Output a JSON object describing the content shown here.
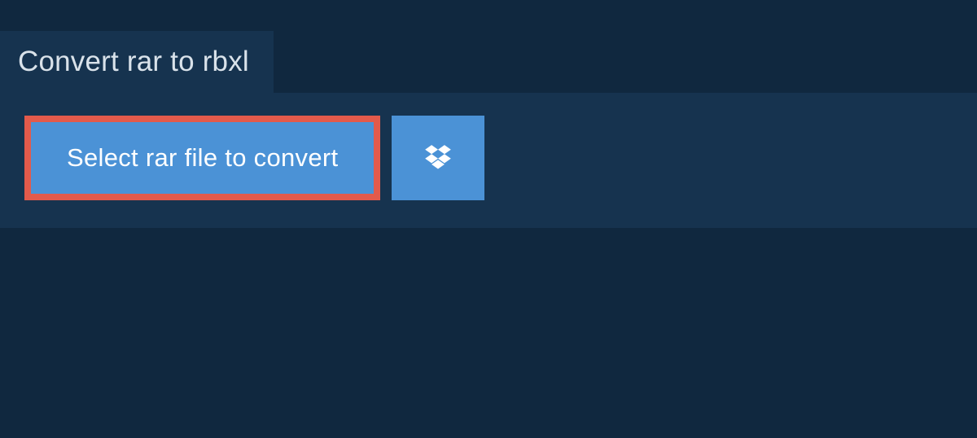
{
  "tab": {
    "title": "Convert rar to rbxl"
  },
  "buttons": {
    "select_label": "Select rar file to convert"
  },
  "colors": {
    "page_bg": "#10283f",
    "panel_bg": "#16334f",
    "button_bg": "#4b92d6",
    "highlight_border": "#e35a4b",
    "text_light": "#d9e2ea"
  }
}
